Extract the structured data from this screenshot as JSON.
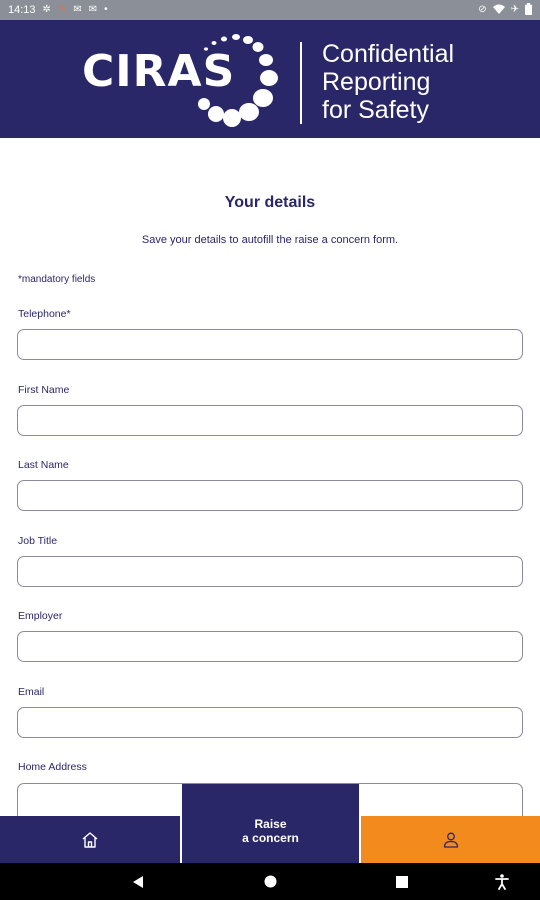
{
  "status_bar": {
    "time": "14:13",
    "left_icons": [
      "settings-icon",
      "notification-icon",
      "mail-icon",
      "mail-icon",
      "dot-icon"
    ],
    "right_icons": [
      "no-sim-icon",
      "wifi-icon",
      "airplane-icon",
      "battery-icon"
    ]
  },
  "header": {
    "logo_text": "CIRAS",
    "tagline_lines": [
      "Confidential",
      "Reporting",
      "for Safety"
    ],
    "background_color": "#2a2768"
  },
  "form": {
    "title": "Your details",
    "subtitle": "Save your details to autofill the raise a concern form.",
    "mandatory_note": "*mandatory fields",
    "fields": [
      {
        "label": "Telephone*",
        "value": "",
        "placeholder": ""
      },
      {
        "label": "First Name",
        "value": "",
        "placeholder": ""
      },
      {
        "label": "Last Name",
        "value": "",
        "placeholder": ""
      },
      {
        "label": "Job Title",
        "value": "",
        "placeholder": ""
      },
      {
        "label": "Employer",
        "value": "",
        "placeholder": ""
      },
      {
        "label": "Email",
        "value": "",
        "placeholder": ""
      },
      {
        "label": "Home Address",
        "value": "",
        "placeholder": ""
      }
    ]
  },
  "bottom_nav": {
    "home_icon": "home-icon",
    "raise_line1": "Raise",
    "raise_line2": "a concern",
    "profile_icon": "person-icon",
    "colors": {
      "primary": "#2a2768",
      "accent": "#f28a1e"
    }
  },
  "android_nav": {
    "buttons": [
      "back-icon",
      "home-circle-icon",
      "recents-icon",
      "accessibility-icon"
    ]
  }
}
